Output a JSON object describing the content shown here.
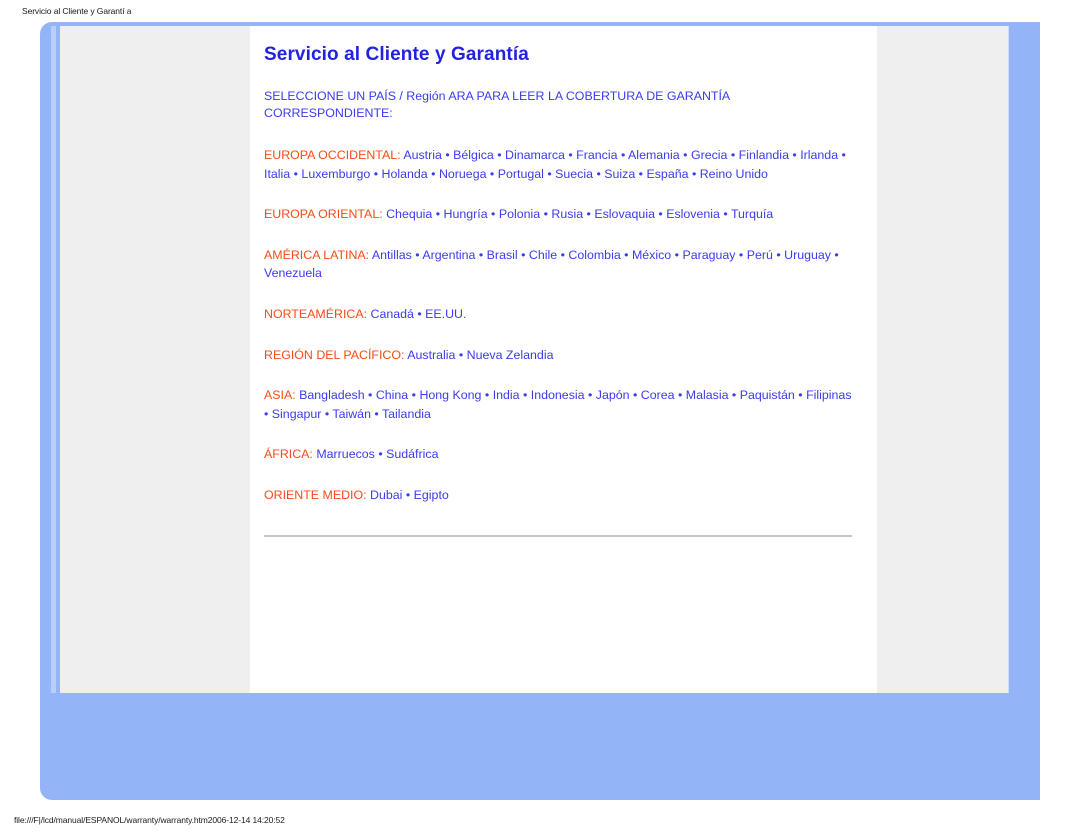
{
  "browser": {
    "header_title": "Servicio al Cliente y Garantí a",
    "status_text": "file:///F|/lcd/manual/ESPANOL/warranty/warranty.htm2006-12-14 14:20:52"
  },
  "colors": {
    "title_blue": "#2222e0",
    "link_blue": "#3b3bf0",
    "region_orange": "#fa4b14",
    "page_blue": "#93b4f7",
    "card_grey": "#efefef"
  },
  "document": {
    "title": "Servicio al Cliente y Garantía",
    "lead": "SELECCIONE UN PAÍS / Región ARA PARA LEER LA COBERTURA DE GARANTÍA CORRESPONDIENTE:",
    "separator": " • ",
    "regions": [
      {
        "label": "EUROPA OCCIDENTAL:",
        "countries": [
          "Austria",
          "Bélgica",
          "Dinamarca",
          "Francia",
          "Alemania",
          "Grecia",
          "Finlandia",
          "Irlanda",
          "Italia",
          "Luxemburgo",
          "Holanda",
          "Noruega",
          "Portugal",
          "Suecia",
          "Suiza",
          "España",
          "Reino Unido"
        ]
      },
      {
        "label": "EUROPA ORIENTAL:",
        "countries": [
          "Chequia",
          "Hungría",
          "Polonia",
          "Rusia",
          "Eslovaquia",
          "Eslovenia",
          "Turquía"
        ]
      },
      {
        "label": "AMÉRICA LATINA:",
        "countries": [
          "Antillas",
          "Argentina",
          "Brasil",
          "Chile",
          "Colombia",
          "México",
          "Paraguay",
          "Perú",
          "Uruguay",
          "Venezuela"
        ]
      },
      {
        "label": "NORTEAMÉRICA:",
        "countries": [
          "Canadá",
          "EE.UU."
        ]
      },
      {
        "label": "REGIÓN DEL PACÍFICO:",
        "countries": [
          "Australia",
          "Nueva Zelandia"
        ]
      },
      {
        "label": "ASIA:",
        "countries": [
          "Bangladesh",
          "China",
          "Hong Kong",
          "India",
          "Indonesia",
          "Japón",
          "Corea",
          "Malasia",
          "Paquistán",
          "Filipinas",
          "Singapur",
          "Taiwán",
          "Tailandia"
        ]
      },
      {
        "label": "ÁFRICA:",
        "countries": [
          "Marruecos",
          "Sudáfrica"
        ]
      },
      {
        "label": "ORIENTE MEDIO:",
        "countries": [
          "Dubai",
          "Egipto"
        ]
      }
    ]
  }
}
